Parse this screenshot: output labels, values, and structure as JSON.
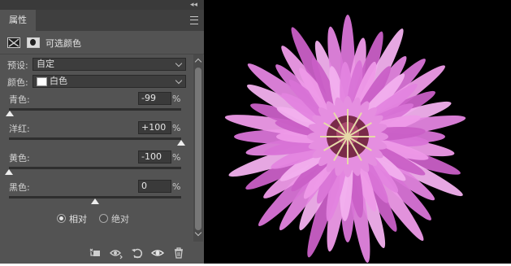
{
  "panel": {
    "tab_label": "属性",
    "collapse_glyph": "◂◂",
    "header_title": "可选颜色",
    "preset": {
      "label": "预设:",
      "value": "自定"
    },
    "colors": {
      "label": "颜色:",
      "value": "白色",
      "swatch_color": "#ffffff"
    },
    "sliders": [
      {
        "label": "青色:",
        "value": "-99",
        "unit": "%",
        "level_percent": -99
      },
      {
        "label": "洋红:",
        "value": "+100",
        "unit": "%",
        "level_percent": 100
      },
      {
        "label": "黄色:",
        "value": "-100",
        "unit": "%",
        "level_percent": -100
      },
      {
        "label": "黑色:",
        "value": "0",
        "unit": "%",
        "level_percent": 0
      }
    ],
    "method": {
      "options": [
        {
          "label": "相对",
          "selected": true
        },
        {
          "label": "绝对",
          "selected": false
        }
      ]
    },
    "footer_icons": [
      "clip-to-layer-icon",
      "view-previous-state-icon",
      "reset-icon",
      "toggle-visibility-icon",
      "delete-icon"
    ]
  },
  "colors": {
    "panel_bg": "#535353",
    "dark_bar": "#3a3a3a",
    "photo_bg": "#000000",
    "petal_pink": "#e58ee0"
  }
}
